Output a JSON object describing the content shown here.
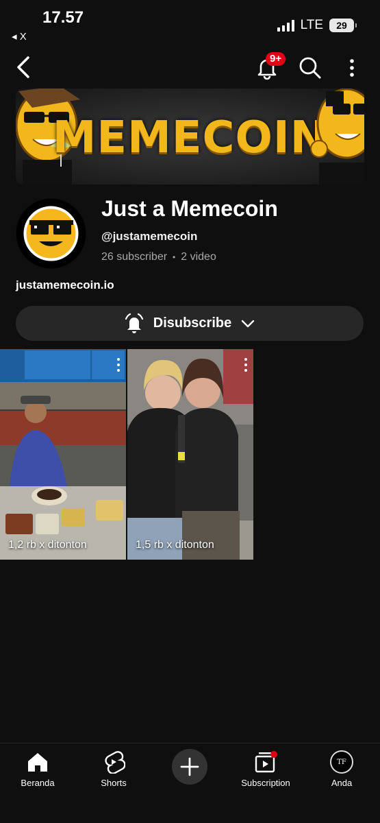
{
  "status": {
    "time": "17.57",
    "back_app": "◂ X",
    "network": "LTE",
    "battery": "29"
  },
  "header": {
    "notification_badge": "9+"
  },
  "banner": {
    "title": "MEMECOIN"
  },
  "channel": {
    "name": "Just a Memecoin",
    "handle": "@justamemecoin",
    "subscribers": "26 subscriber",
    "videos": "2 video",
    "link": "justamemecoin.io",
    "subscribe_label": "Disubscribe"
  },
  "shorts": [
    {
      "views": "1,2 rb x ditonton"
    },
    {
      "views": "1,5 rb x ditonton"
    }
  ],
  "bottom_nav": {
    "home": "Beranda",
    "shorts": "Shorts",
    "subscriptions": "Subscription",
    "you": "Anda",
    "you_initials": "TF"
  },
  "colors": {
    "background": "#0f0f0f",
    "badge": "#e30016",
    "button": "#272727",
    "gold": "#f2b71a"
  }
}
